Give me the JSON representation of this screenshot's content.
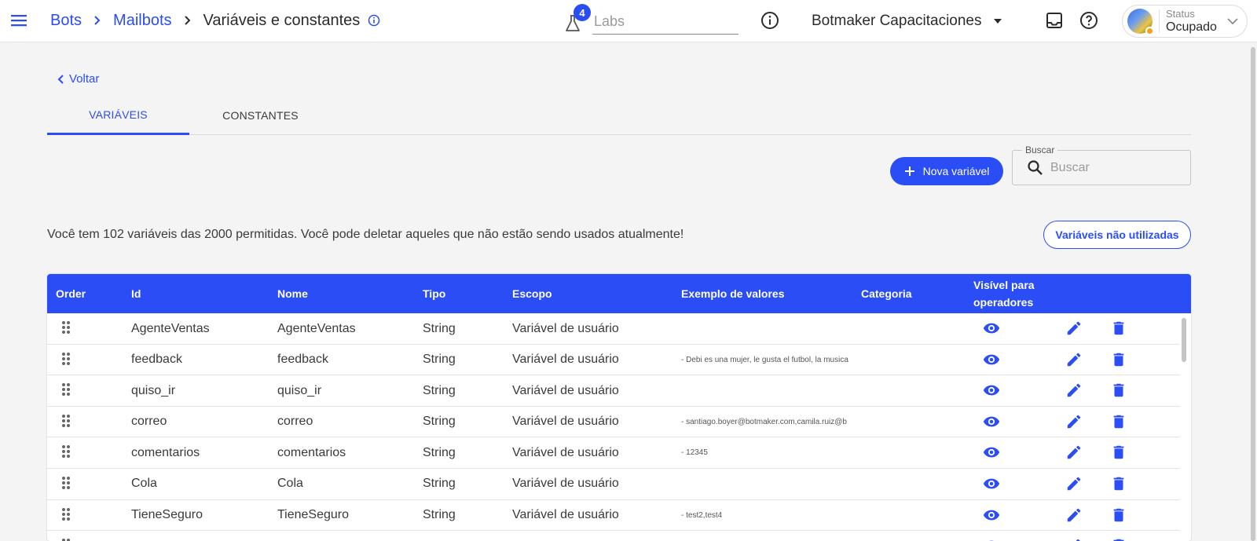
{
  "breadcrumb": {
    "items": [
      "Bots",
      "Mailbots"
    ],
    "current": "Variáveis e constantes"
  },
  "labs": {
    "badge": "4",
    "placeholder": "Labs"
  },
  "account": {
    "name": "Botmaker Capacitaciones"
  },
  "status": {
    "label": "Status",
    "value": "Ocupado"
  },
  "back": {
    "label": "Voltar"
  },
  "tabs": [
    {
      "label": "VARIÁVEIS",
      "active": true
    },
    {
      "label": "CONSTANTES",
      "active": false
    }
  ],
  "toolbar": {
    "new_label": "Nova variável"
  },
  "search": {
    "legend": "Buscar",
    "placeholder": "Buscar"
  },
  "info": {
    "text": "Você tem 102 variáveis das 2000 permitidas. Você pode deletar aqueles que não estão sendo usados atualmente!",
    "unused_label": "Variáveis não utilizadas"
  },
  "table": {
    "headers": {
      "order": "Order",
      "id": "Id",
      "nome": "Nome",
      "tipo": "Tipo",
      "escopo": "Escopo",
      "exemplo": "Exemplo de valores",
      "categoria": "Categoria",
      "visivel_1": "Visível para",
      "visivel_2": "operadores"
    },
    "rows": [
      {
        "id": "AgenteVentas",
        "nome": "AgenteVentas",
        "tipo": "String",
        "escopo": "Variável de usuário",
        "exemplo": ""
      },
      {
        "id": "feedback",
        "nome": "feedback",
        "tipo": "String",
        "escopo": "Variável de usuário",
        "exemplo": "- Debi es una mujer, le gusta el futbol, la musica"
      },
      {
        "id": "quiso_ir",
        "nome": "quiso_ir",
        "tipo": "String",
        "escopo": "Variável de usuário",
        "exemplo": ""
      },
      {
        "id": "correo",
        "nome": "correo",
        "tipo": "String",
        "escopo": "Variável de usuário",
        "exemplo": "- santiago.boyer@botmaker.com,camila.ruiz@b"
      },
      {
        "id": "comentarios",
        "nome": "comentarios",
        "tipo": "String",
        "escopo": "Variável de usuário",
        "exemplo": "- 12345"
      },
      {
        "id": "Cola",
        "nome": "Cola",
        "tipo": "String",
        "escopo": "Variável de usuário",
        "exemplo": ""
      },
      {
        "id": "TieneSeguro",
        "nome": "TieneSeguro",
        "tipo": "String",
        "escopo": "Variável de usuário",
        "exemplo": "- test2,test4"
      },
      {
        "id": "",
        "nome": "",
        "tipo": "",
        "escopo": "",
        "exemplo": ""
      }
    ]
  },
  "colors": {
    "accent": "#2b4df5",
    "status_dot": "#f5a21b"
  }
}
